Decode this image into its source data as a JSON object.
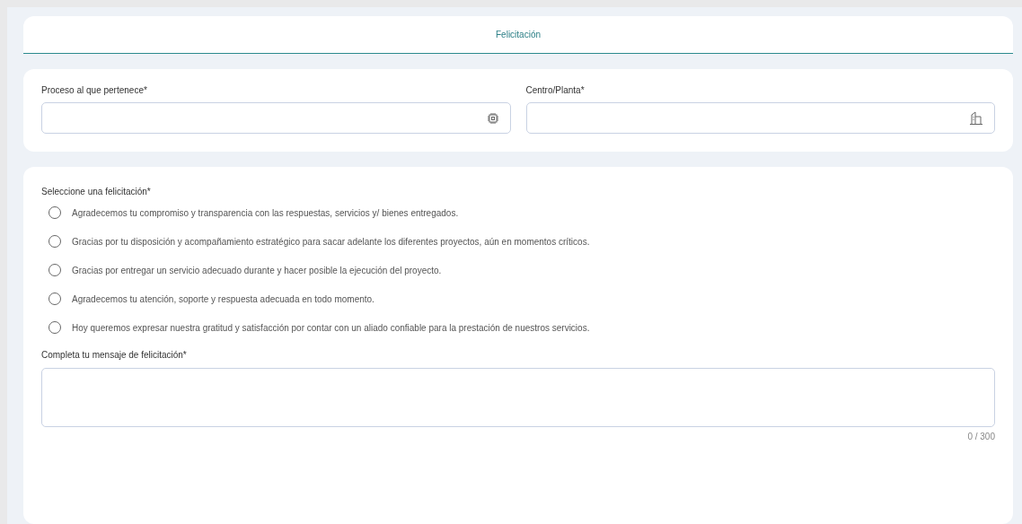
{
  "header": {
    "title": "Felicitación"
  },
  "fields": [
    {
      "label": "Proceso al que pertenece*",
      "kind": "chip"
    },
    {
      "label": "Centro/Planta*",
      "kind": "building"
    }
  ],
  "options_label": "Seleccione una felicitación*",
  "options": [
    {
      "text": "Agradecemos tu compromiso y transparencia con las respuestas, servicios y/ bienes entregados.",
      "selected": false
    },
    {
      "text": "Gracias por tu disposición y acompañamiento estratégico para sacar adelante los diferentes proyectos, aún en momentos críticos.",
      "selected": false
    },
    {
      "text": "Gracias por entregar un servicio adecuado durante y hacer posible la ejecución del proyecto.",
      "selected": false
    },
    {
      "text": "Agradecemos tu atención, soporte y respuesta adecuada en todo momento.",
      "selected": false
    },
    {
      "text": "Hoy queremos expresar nuestra gratitud y satisfacción por contar con un aliado confiable para la prestación de nuestros servicios.",
      "selected": false
    }
  ],
  "message": {
    "label": "Completa tu mensaje de felicitación*",
    "counter": "0 / 300"
  }
}
